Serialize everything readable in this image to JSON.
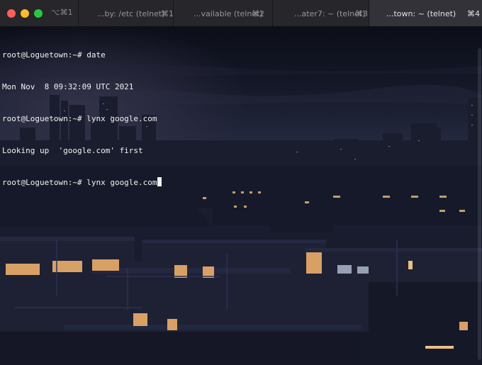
{
  "window": {
    "shortcut": "⌥⌘1",
    "colors": {
      "close": "#fe5f57",
      "minimize": "#febc2e",
      "maximize": "#28c840"
    }
  },
  "tabs": [
    {
      "title": "...by: /etc (telnet)",
      "shortcut": "⌘1",
      "active": false
    },
    {
      "title": "...vailable (telnet)",
      "shortcut": "⌘2",
      "active": false
    },
    {
      "title": "...ater7: ~ (telnet)",
      "shortcut": "⌘3",
      "active": false
    },
    {
      "title": "...town: ~ (telnet)",
      "shortcut": "⌘4",
      "active": true
    }
  ],
  "terminal": {
    "lines": [
      "root@Loguetown:~# date",
      "Mon Nov  8 09:32:09 UTC 2021",
      "root@Loguetown:~# lynx google.com",
      "Looking up  'google.com' first",
      "root@Loguetown:~# lynx google.com"
    ]
  }
}
